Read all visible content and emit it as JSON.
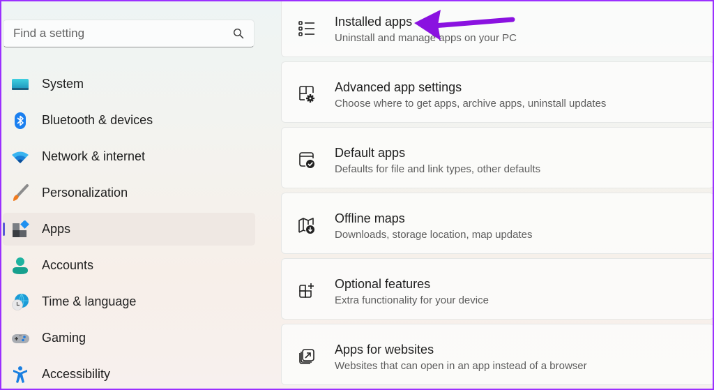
{
  "search": {
    "placeholder": "Find a setting",
    "icon": "search-icon"
  },
  "sidebar": {
    "items": [
      {
        "label": "System",
        "icon": "system-monitor-icon",
        "active": false
      },
      {
        "label": "Bluetooth & devices",
        "icon": "bluetooth-icon",
        "active": false
      },
      {
        "label": "Network & internet",
        "icon": "wifi-icon",
        "active": false
      },
      {
        "label": "Personalization",
        "icon": "paintbrush-icon",
        "active": false
      },
      {
        "label": "Apps",
        "icon": "apps-icon",
        "active": true
      },
      {
        "label": "Accounts",
        "icon": "person-icon",
        "active": false
      },
      {
        "label": "Time & language",
        "icon": "globe-clock-icon",
        "active": false
      },
      {
        "label": "Gaming",
        "icon": "gamepad-icon",
        "active": false
      },
      {
        "label": "Accessibility",
        "icon": "accessibility-icon",
        "active": false
      }
    ],
    "accent_color": "#5b57d6"
  },
  "main": {
    "cards": [
      {
        "title": "Installed apps",
        "description": "Uninstall and manage apps on your PC",
        "icon": "list-icon"
      },
      {
        "title": "Advanced app settings",
        "description": "Choose where to get apps, archive apps, uninstall updates",
        "icon": "app-settings-icon"
      },
      {
        "title": "Default apps",
        "description": "Defaults for file and link types, other defaults",
        "icon": "default-apps-icon"
      },
      {
        "title": "Offline maps",
        "description": "Downloads, storage location, map updates",
        "icon": "map-download-icon"
      },
      {
        "title": "Optional features",
        "description": "Extra functionality for your device",
        "icon": "add-feature-icon"
      },
      {
        "title": "Apps for websites",
        "description": "Websites that can open in an app instead of a browser",
        "icon": "open-external-icon"
      }
    ]
  },
  "annotation": {
    "arrow_color": "#8a12e0",
    "frame_color": "#9b30ff",
    "points_to": "Installed apps"
  }
}
